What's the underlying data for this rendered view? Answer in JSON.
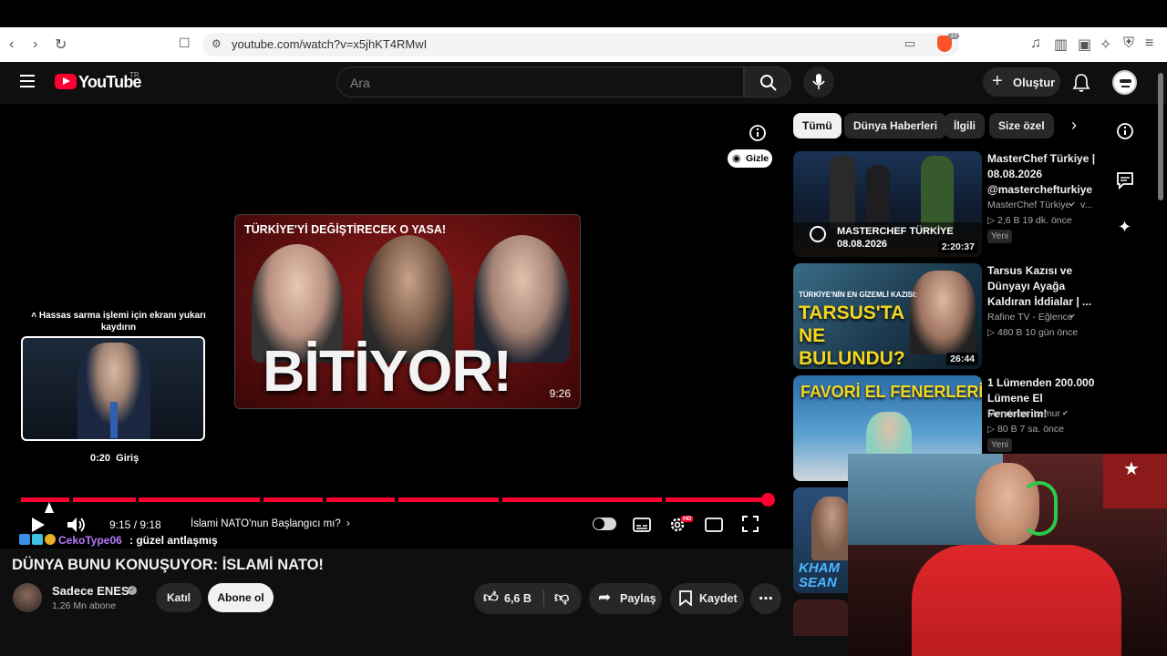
{
  "browser": {
    "url": "youtube.com/watch?v=x5jhKT4RMwI",
    "shield_count": "33"
  },
  "header": {
    "logo_text": "YouTube",
    "region": "TR",
    "search_placeholder": "Ara",
    "create_label": "Oluştur"
  },
  "player": {
    "endcard_headline": "TÜRKİYE'Yİ DEĞİŞTİRECEK O YASA!",
    "endcard_big": "BİTİYOR!",
    "endcard_duration": "9:26",
    "hide_label": "Gizle",
    "scrub_hint": "Hassas sarma işlemi için ekranı yukarı kaydırın",
    "preview_time": "0:20",
    "preview_chapter": "Giriş",
    "time_display": "9:15 / 9:18",
    "chapter": "İslami NATO'nun Başlangıcı mı?",
    "progress_fraction": 0.99,
    "hd_badge": "HD"
  },
  "overlay_chat": {
    "user": "CekoType06",
    "message": ": güzel antlaşmış"
  },
  "video": {
    "title": "DÜNYA BUNU KONUŞUYOR: İSLAMİ NATO!",
    "channel": "Sadece ENES",
    "subscribers": "1,26 Mn abone",
    "join_label": "Katıl",
    "subscribe_label": "Abone ol",
    "likes": "6,6 B",
    "share_label": "Paylaş",
    "save_label": "Kaydet"
  },
  "chips": [
    "Tümü",
    "Dünya Haberleri",
    "İlgili",
    "Size özel"
  ],
  "recommendations": [
    {
      "title": "MasterChef Türkiye | 08.08.2026 @masterchefturkiye",
      "channel": "MasterChef Türkiye",
      "meta": "2,6 B   19 dk. önce",
      "badge": "Yeni",
      "duration": "2:20:37",
      "thumb_text1": "MASTERCHEF TÜRKİYE",
      "thumb_text2": "08.08.2026"
    },
    {
      "title": "Tarsus Kazısı ve Dünyayı Ayağa Kaldıran İddialar | ...",
      "channel": "Rafine TV - Eğlence",
      "meta": "480 B   10 gün önce",
      "badge": "",
      "duration": "26:44",
      "thumb_text1": "TÜRKİYE'NİN EN GİZEMLİ KAZISI:",
      "thumb_text2": "TARSUS'TA NE BULUNDU?"
    },
    {
      "title": "1 Lümenden 200.000 Lümene El Fenerlerim!",
      "channel": "Mendebur Lemur",
      "meta": "80 B   7 sa. önce",
      "badge": "Yeni",
      "duration": "",
      "thumb_text1": "FAVORİ EL FENERLERİM",
      "thumb_text2": ""
    },
    {
      "title": "",
      "channel": "",
      "meta": "",
      "badge": "",
      "duration": "",
      "thumb_text1": "KHAM",
      "thumb_text2": "SEAN"
    }
  ],
  "colors": {
    "accent_red": "#ff0033",
    "background": "#0f0f0f",
    "chip_bg": "#272727"
  }
}
